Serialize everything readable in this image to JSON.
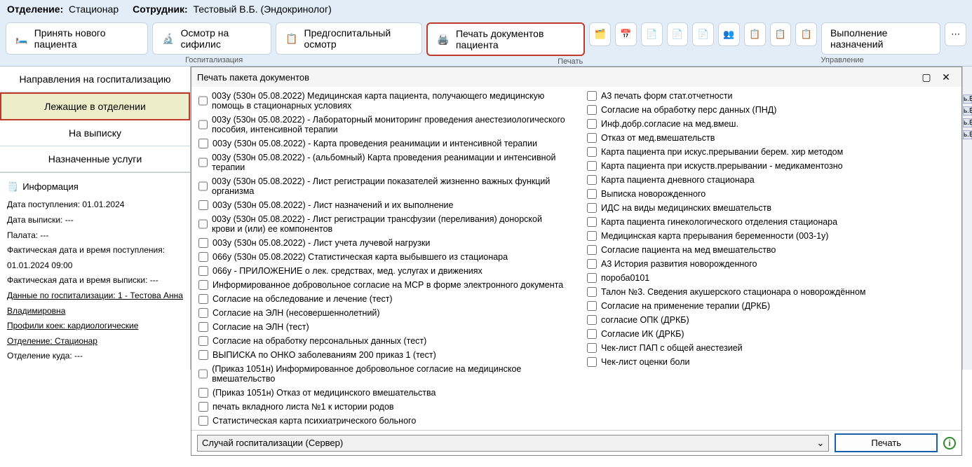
{
  "header": {
    "dept_label": "Отделение:",
    "dept_value": "Стационар",
    "staff_label": "Сотрудник:",
    "staff_value": "Тестовый В.Б. (Эндокринолог)"
  },
  "toolbar": {
    "new_patient": "Принять нового пациента",
    "syphilis": "Осмотр на сифилис",
    "prehospital": "Предгоспитальный осмотр",
    "print_docs": "Печать документов пациента",
    "assignments": "Выполнение назначений",
    "group_hospitalization": "Госпитализация",
    "group_print": "Печать",
    "group_management": "Управление"
  },
  "sidebar": {
    "tabs": [
      "Направления на госпитализацию",
      "Лежащие в отделении",
      "На выписку",
      "Назначенные услуги"
    ]
  },
  "info": {
    "title": "Информация",
    "admit_date": "Дата поступления: 01.01.2024",
    "discharge_date": "Дата выписки: ---",
    "ward": "Палата: ---",
    "actual_admit": "Фактическая дата и время поступления: 01.01.2024 09:00",
    "actual_discharge": "Фактическая дата и время выписки: ---",
    "hosp_data": "Данные по госпитализации: 1 - Тестова Анна Владимировна",
    "bed_profile": "Профили коек: кардиологические",
    "department": "Отделение: Стационар",
    "department_to": "Отделение куда: ---"
  },
  "dialog": {
    "title": "Печать пакета документов",
    "col1": [
      "003у (530н 05.08.2022) Медицинская карта пациента, получающего медицинскую помощь в стационарных условиях",
      "003у (530н 05.08.2022) - Лабораторный мониторинг проведения анестезиологического пособия, интенсивной терапии",
      "003у (530н 05.08.2022) - Карта проведения реанимации и интенсивной терапии",
      "003у (530н 05.08.2022) - (альбомный) Карта проведения реанимации и интенсивной терапии",
      "003у (530н 05.08.2022) - Лист регистрации показателей жизненно важных функций организма",
      "003у (530н 05.08.2022) - Лист назначений и их выполнение",
      "003у (530н 05.08.2022) - Лист регистрации трансфузии (переливания) донорской крови и (или) ее компонентов",
      "003у (530н 05.08.2022) - Лист учета лучевой нагрузки",
      "066у (530н 05.08.2022) Статистическая карта выбывшего из стационара",
      "066у - ПРИЛОЖЕНИЕ о лек. средствах, мед. услугах и движениях",
      "Информированное добровольное согласие на МСР в форме электронного документа",
      "Согласие на обследование и лечение (тест)",
      "Согласие на ЭЛН (несовершеннолетний)",
      "Согласие на ЭЛН (тест)",
      "Согласие на обработку персональных данных (тест)",
      "ВЫПИСКА по ОНКО заболеваниям 200 приказ 1 (тест)",
      "(Приказ 1051н) Информированное добровольное согласие на медицинское вмешательство",
      "(Приказ 1051н) Отказ от медицинского вмешательства",
      "печать вкладного листа №1 к истории родов",
      "Статистическая карта психиатрического больного"
    ],
    "col2": [
      "А3 печать форм стат.отчетности",
      "Согласие на обработку перс данных (ПНД)",
      "Инф.добр.согласие на мед.вмеш.",
      "Отказ от мед.вмешательств",
      "Карта пациента при искус.прерывании берем. хир методом",
      "Карта пациента при искуств.прерывании - медикаментозно",
      "Карта пациента дневного стационара",
      "Выписка новорожденного",
      "ИДС на виды медицинских вмешательств",
      "Карта пациента гинекологического отделения  стационара",
      "Медицинская карта прерывания беременности (003-1у)",
      "Согласие пациента на мед вмешательство",
      "А3 История развития новорожденного",
      "пороба0101",
      "Талон №3. Сведения акушерского стационара о новорождённом",
      "Согласие на применение терапии (ДРКБ)",
      "согласие ОПК (ДРКБ)",
      "Согласие ИК (ДРКБ)",
      "Чек-лист ПАП с общей анестезией",
      "Чек-лист оценки боли"
    ],
    "combo": "Случай госпитализации (Сервер)",
    "print_btn": "Печать"
  },
  "right_strip": [
    "ь.Б.",
    "ь.Б.",
    "ь.Б.",
    "ь.Б."
  ]
}
